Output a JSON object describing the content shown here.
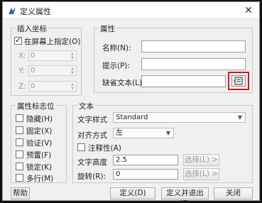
{
  "window": {
    "title": "定义属性",
    "close_glyph": "✕"
  },
  "insert_point": {
    "title": "插入坐标",
    "on_screen_label": "在屏幕上指定(O)",
    "on_screen_checked": true,
    "x_label": "X:",
    "x_value": "0",
    "y_label": "Y:",
    "y_value": "0",
    "z_label": "Z:",
    "z_value": "0"
  },
  "attribute": {
    "title": "属性",
    "name_label": "名称(N):",
    "name_value": "",
    "prompt_label": "提示(P):",
    "prompt_value": "",
    "default_label": "缺省文本(L):",
    "default_value": "",
    "field_icon": "insert-field-icon"
  },
  "mode": {
    "title": "属性标志位",
    "items": [
      {
        "label": "隐藏(H)",
        "checked": false
      },
      {
        "label": "固定(X)",
        "checked": false
      },
      {
        "label": "验证(V)",
        "checked": false
      },
      {
        "label": "预置(F)",
        "checked": false
      },
      {
        "label": "锁定(K)",
        "checked": false
      },
      {
        "label": "多行(M)",
        "checked": false
      }
    ]
  },
  "text": {
    "title": "文本",
    "style_label": "文字样式",
    "style_value": "Standard",
    "justify_label": "对齐方式",
    "justify_value": "左",
    "annotative_label": "注释性(A)",
    "annotative_checked": false,
    "height_label": "文字高度",
    "height_value": "2.5",
    "rotation_label": "旋转(R):",
    "rotation_value": "0",
    "pick_label_1": "选择(L) >",
    "pick_label_2": "选择(L) >"
  },
  "buttons": {
    "help": "帮助",
    "ok": "定义(D)",
    "ok_exit": "定义并退出(E)",
    "close": "关闭"
  },
  "colors": {
    "highlight": "#e0141e"
  }
}
